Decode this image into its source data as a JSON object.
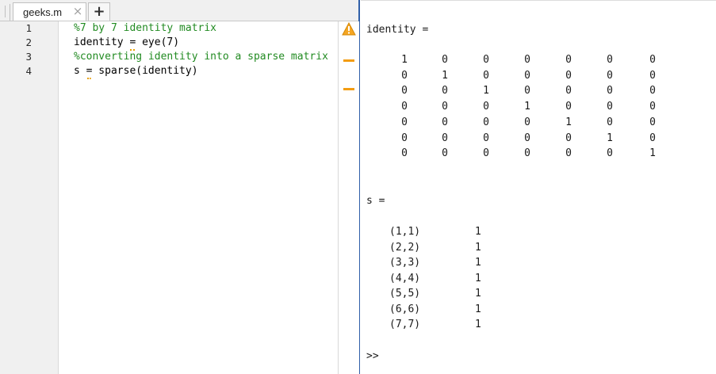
{
  "editor": {
    "tab_label": "geeks.m",
    "tab_close": "×",
    "add_tab": "+",
    "line_numbers": [
      "1",
      "2",
      "3",
      "4"
    ],
    "code": {
      "line1": "%7 by 7 identity matrix",
      "line2_pre": "identity ",
      "line2_eq": "=",
      "line2_post": " eye(7)",
      "line3": "%converting identity into a sparse matrix",
      "line4_pre": "s ",
      "line4_eq": "=",
      "line4_post": " sparse(identity)"
    },
    "warning_icon": "warning-triangle-icon",
    "colors": {
      "comment": "#228b22",
      "warning": "#f39c12",
      "active_border": "#2f5fa8"
    }
  },
  "command_window": {
    "identity_header": "identity =",
    "identity_matrix": [
      [
        1,
        0,
        0,
        0,
        0,
        0,
        0
      ],
      [
        0,
        1,
        0,
        0,
        0,
        0,
        0
      ],
      [
        0,
        0,
        1,
        0,
        0,
        0,
        0
      ],
      [
        0,
        0,
        0,
        1,
        0,
        0,
        0
      ],
      [
        0,
        0,
        0,
        0,
        1,
        0,
        0
      ],
      [
        0,
        0,
        0,
        0,
        0,
        1,
        0
      ],
      [
        0,
        0,
        0,
        0,
        0,
        0,
        1
      ]
    ],
    "sparse_header": "s =",
    "sparse_entries": [
      {
        "index": "(1,1)",
        "value": "1"
      },
      {
        "index": "(2,2)",
        "value": "1"
      },
      {
        "index": "(3,3)",
        "value": "1"
      },
      {
        "index": "(4,4)",
        "value": "1"
      },
      {
        "index": "(5,5)",
        "value": "1"
      },
      {
        "index": "(6,6)",
        "value": "1"
      },
      {
        "index": "(7,7)",
        "value": "1"
      }
    ],
    "prompt": ">>"
  }
}
